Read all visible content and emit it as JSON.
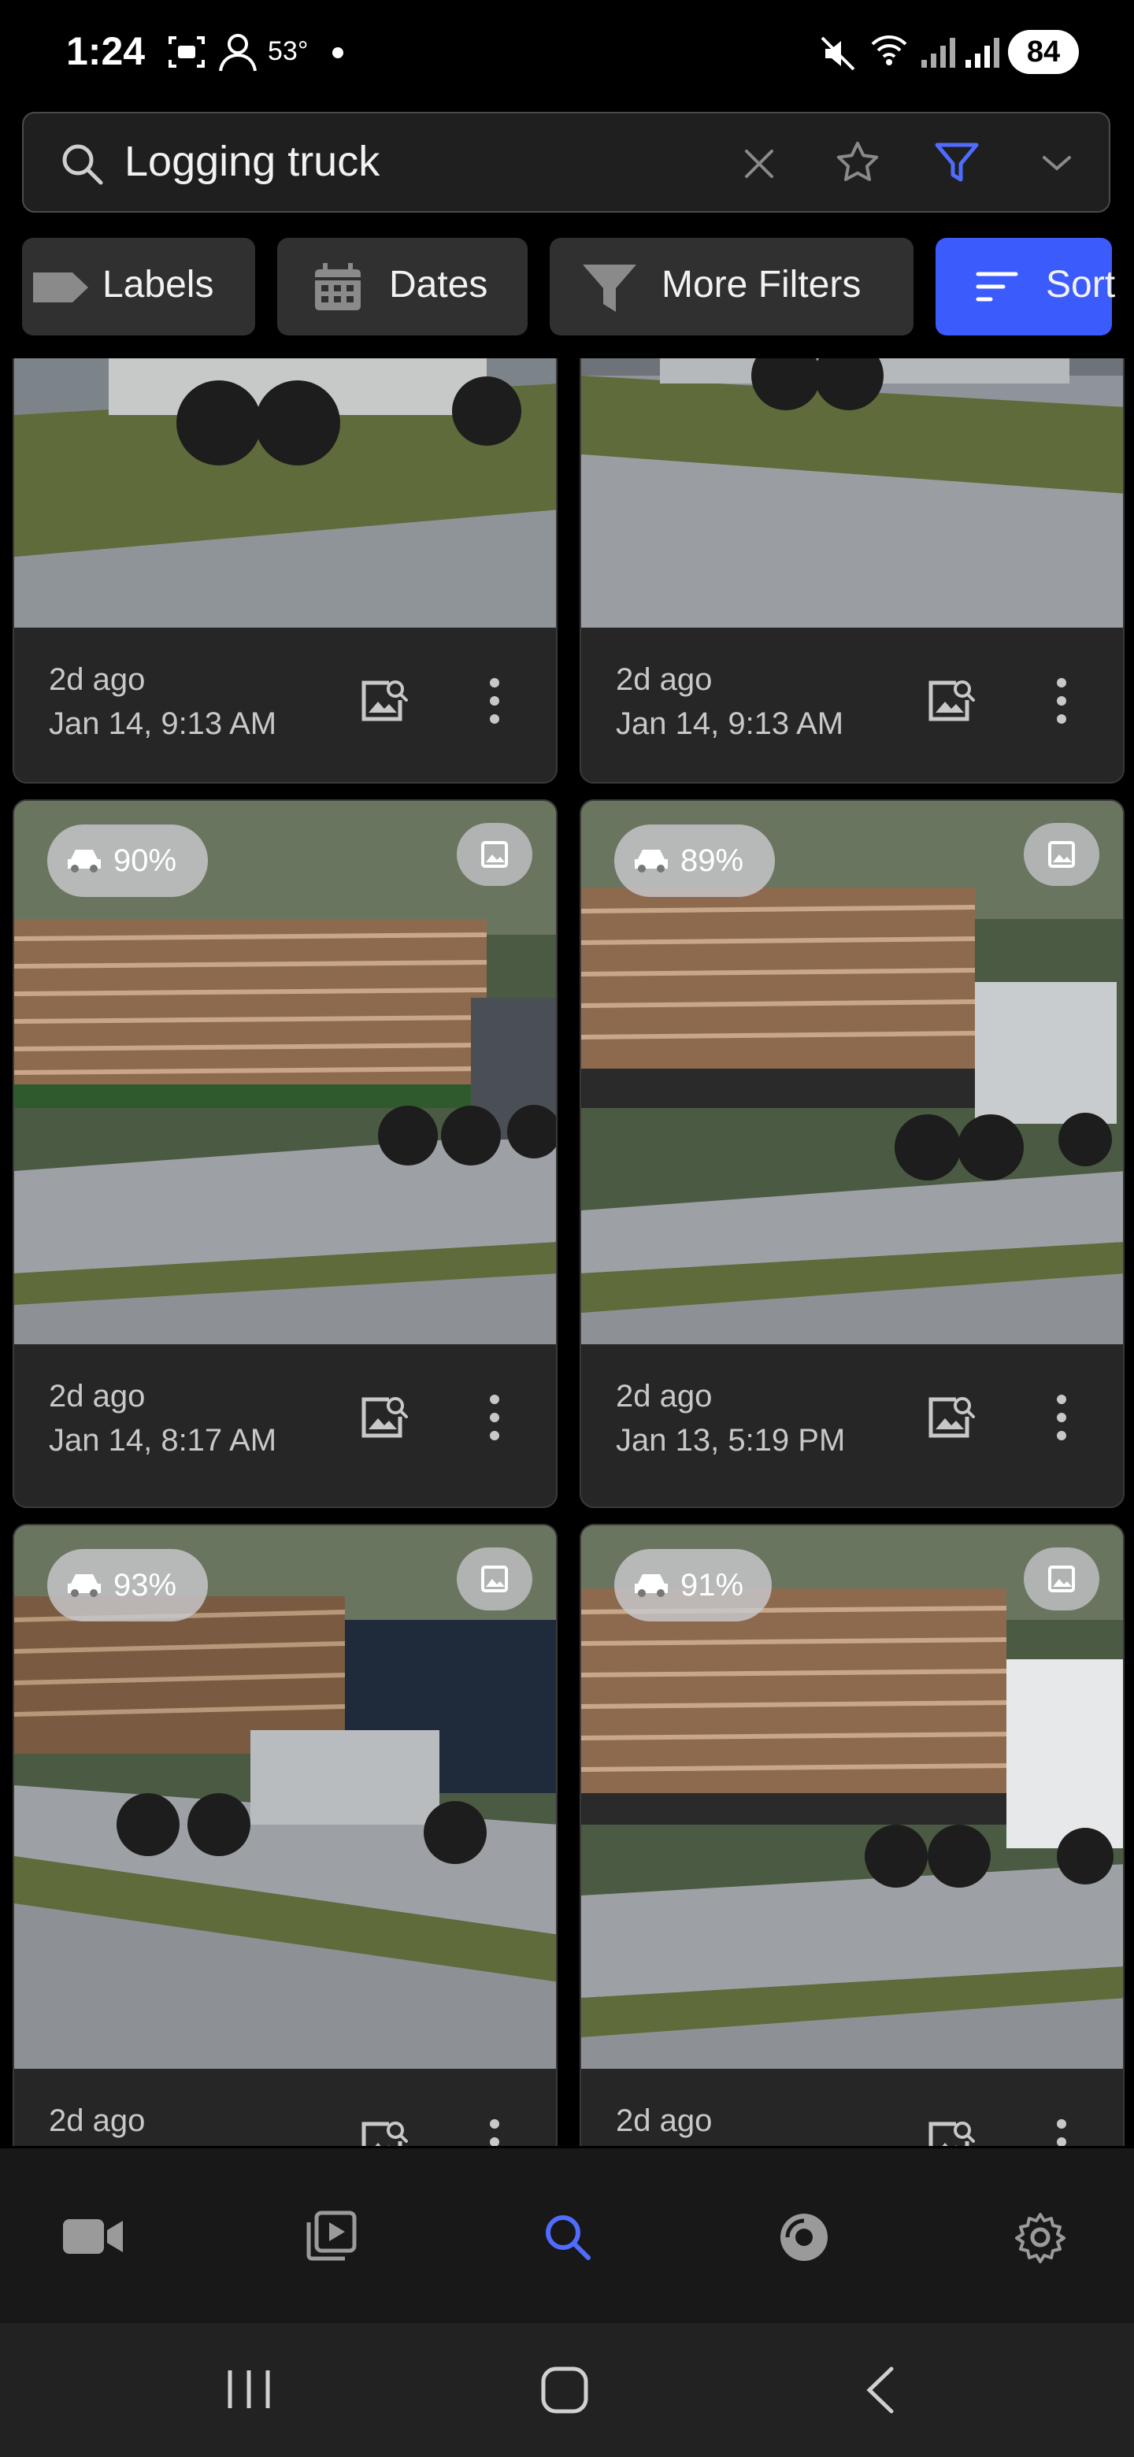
{
  "status_bar": {
    "time": "1:24",
    "temperature": "53°",
    "battery": "84"
  },
  "search": {
    "query": "Logging truck"
  },
  "filters": {
    "labels": "Labels",
    "dates": "Dates",
    "more_filters": "More Filters",
    "sort": "Sort"
  },
  "cards": [
    {
      "ago": "2d ago",
      "date": "Jan 14, 9:13 AM"
    },
    {
      "ago": "2d ago",
      "date": "Jan 14, 9:13 AM"
    },
    {
      "ago": "2d ago",
      "date": "Jan 14, 8:17 AM",
      "confidence": "90%"
    },
    {
      "ago": "2d ago",
      "date": "Jan 13, 5:19 PM",
      "confidence": "89%"
    },
    {
      "ago": "2d ago",
      "date": "",
      "confidence": "93%"
    },
    {
      "ago": "2d ago",
      "date": "",
      "confidence": "91%"
    }
  ],
  "bottom_nav": {
    "items": [
      "camera-icon",
      "playback-icon",
      "search-icon",
      "detection-icon",
      "settings-icon"
    ],
    "active": "search-icon"
  },
  "colors": {
    "accent": "#3b5bfd",
    "background": "#000000",
    "card": "#262626"
  }
}
